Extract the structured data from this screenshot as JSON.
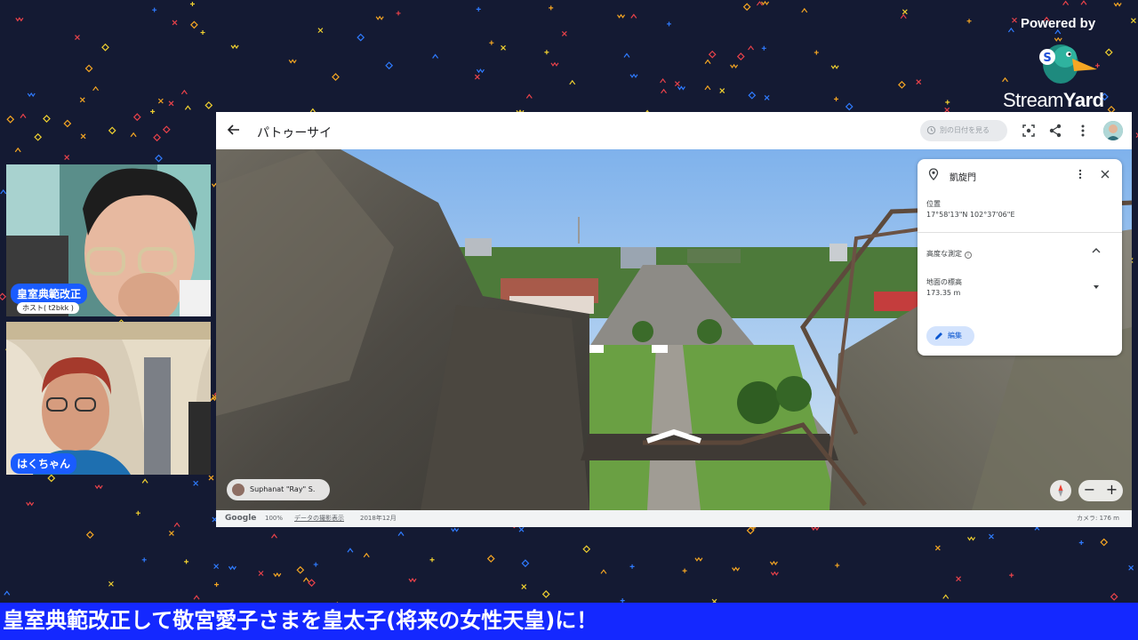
{
  "branding": {
    "powered_by": "Powered by",
    "name_part1": "Stream",
    "name_part2": "Yard",
    "colors": {
      "teal": "#1e8a7e",
      "orange": "#f5a623"
    }
  },
  "participants": [
    {
      "name": "皇室典範改正",
      "role": "ホスト( t2bkk )"
    },
    {
      "name": "はくちゃん"
    }
  ],
  "maps": {
    "title": "パトゥーサイ",
    "date_button": "別の日付を見る",
    "place_card": {
      "place_name": "凱旋門",
      "location_label": "位置",
      "coordinates": "17°58'13\"N 102°37'06\"E",
      "elevation_section": "高度な測定",
      "ground_label": "地面の標高",
      "ground_value": "173.35 m",
      "edit_label": "編集"
    },
    "contributor": "Suphanat \"Ray\" S.",
    "footer": {
      "logo": "Google",
      "zoom": "100%",
      "history": "データの撮影表示",
      "date": "2018年12月",
      "camera": "カメラ: 176 m"
    },
    "zoom_out": "−",
    "zoom_in": "+"
  },
  "ticker": {
    "text": "皇室典範改正して敬宮愛子さまを皇太子(将来の女性天皇)に！",
    "color": "#1428ff"
  }
}
